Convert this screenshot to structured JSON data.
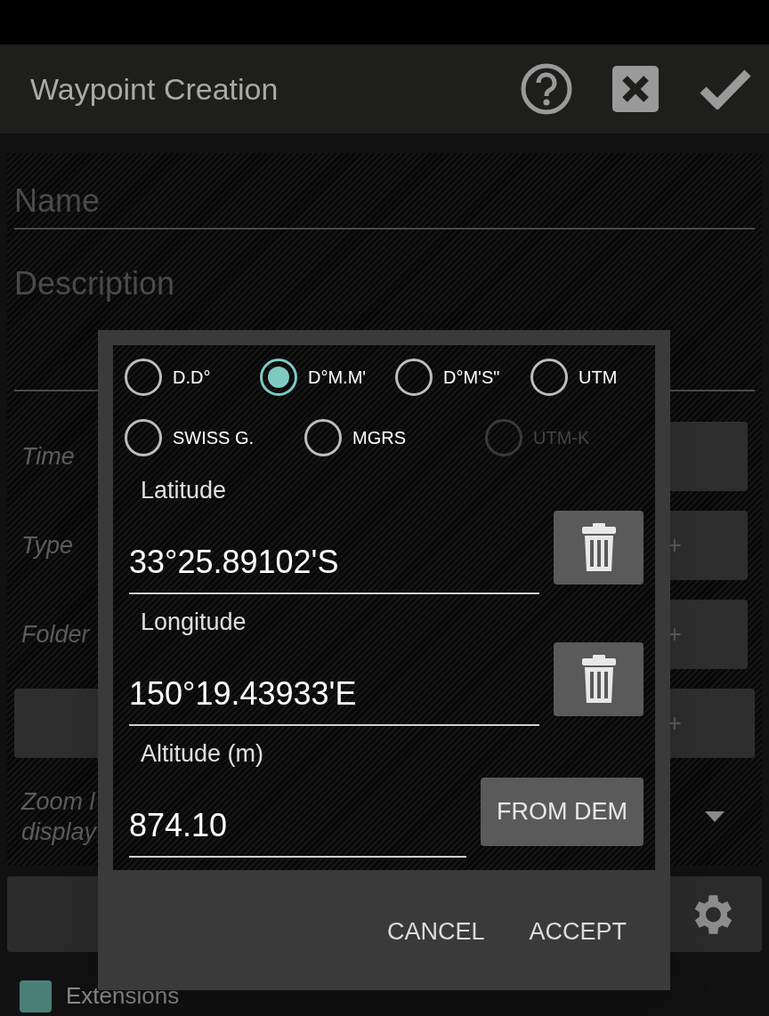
{
  "title_bar": {
    "title": "Waypoint Creation"
  },
  "form": {
    "name": {
      "placeholder": "Name"
    },
    "description": {
      "placeholder": "Description"
    },
    "rows": [
      {
        "kind": "button",
        "label": "Time"
      },
      {
        "kind": "add",
        "label": "Type",
        "add": "+"
      },
      {
        "kind": "add",
        "label": "Folder",
        "add": "+"
      },
      {
        "kind": "wide",
        "add": "+"
      },
      {
        "kind": "dropdown",
        "label": "Zoom l",
        "label_2": "display"
      },
      {
        "kind": "settings"
      }
    ],
    "extensions": {
      "label": "Extensions",
      "checked": true
    }
  },
  "dialog": {
    "formats": [
      [
        {
          "label": "D.D°",
          "selected": false,
          "disabled": false
        },
        {
          "label": "D°M.M'",
          "selected": true,
          "disabled": false
        },
        {
          "label": "D°M'S\"",
          "selected": false,
          "disabled": false
        },
        {
          "label": "UTM",
          "selected": false,
          "disabled": false
        }
      ],
      [
        {
          "label": "SWISS G.",
          "selected": false,
          "disabled": false
        },
        {
          "label": "MGRS",
          "selected": false,
          "disabled": false
        },
        {
          "label": "UTM-K",
          "selected": false,
          "disabled": true
        }
      ]
    ],
    "fields": [
      {
        "kind": "clear",
        "label": "Latitude",
        "value": "33°25.89102'S"
      },
      {
        "kind": "clear",
        "label": "Longitude",
        "value": "150°19.43933'E"
      },
      {
        "kind": "dem",
        "label": "Altitude (m)",
        "value": "874.10",
        "button": "FROM DEM"
      }
    ],
    "buttons": [
      "CANCEL",
      "ACCEPT"
    ]
  }
}
